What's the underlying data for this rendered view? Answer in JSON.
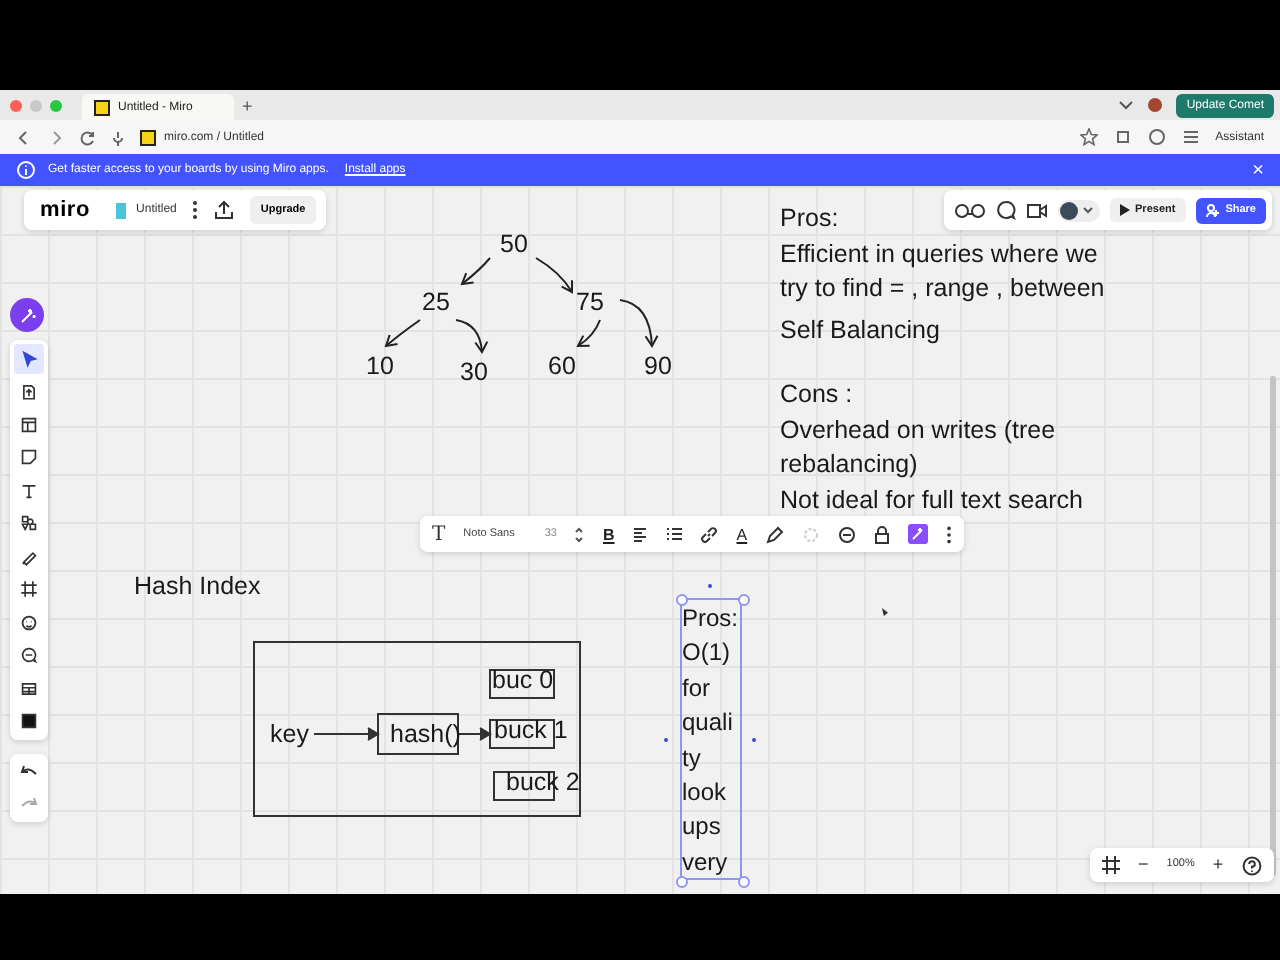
{
  "browser": {
    "tab_title": "Untitled - Miro",
    "new_tab": "+",
    "url": "miro.com / Untitled",
    "update_button": "Update Comet",
    "assistant": "Assistant"
  },
  "banner": {
    "message": "Get faster access to your boards by using Miro apps.",
    "link": "Install apps",
    "close": "×"
  },
  "board": {
    "logo": "miro",
    "name": "Untitled",
    "upgrade": "Upgrade",
    "present": "Present",
    "share": "Share"
  },
  "tools": [
    {
      "kind": "cursor",
      "selected": true
    },
    {
      "kind": "upload",
      "selected": false
    },
    {
      "kind": "layout",
      "selected": false
    },
    {
      "kind": "sticky",
      "selected": false
    },
    {
      "kind": "text",
      "selected": false
    },
    {
      "kind": "shapes",
      "selected": false
    },
    {
      "kind": "pen",
      "selected": false
    },
    {
      "kind": "frame",
      "selected": false
    },
    {
      "kind": "emoji",
      "selected": false
    },
    {
      "kind": "comment",
      "selected": false
    },
    {
      "kind": "table",
      "selected": false
    },
    {
      "kind": "embed",
      "selected": false
    }
  ],
  "tree": {
    "nodes": [
      "50",
      "25",
      "75",
      "10",
      "30",
      "60",
      "90"
    ]
  },
  "notes": [
    {
      "lines": [
        "Pros:",
        "Efficient in queries where we",
        "try to find = , range , between"
      ]
    },
    {
      "lines": [
        "Self Balancing"
      ]
    },
    {
      "lines": [
        "Cons :",
        "Overhead on writes (tree",
        "rebalancing)",
        "Not ideal for full text search"
      ]
    }
  ],
  "hash_diagram": {
    "title": "Hash Index",
    "key": "key",
    "function": "hash()",
    "buckets": [
      "buc 0",
      "buck 1",
      "buck 2"
    ]
  },
  "selected_note": {
    "lines": [
      "Pros:",
      "O(1)",
      "for",
      "quali",
      "ty",
      "look",
      "ups",
      "very"
    ]
  },
  "format_toolbar": {
    "text_style": "T",
    "font": "Noto Sans",
    "size": "33",
    "bold": "B",
    "text_color": "A"
  },
  "zoom": {
    "percent": "100%",
    "minus": "−",
    "plus": "+"
  }
}
